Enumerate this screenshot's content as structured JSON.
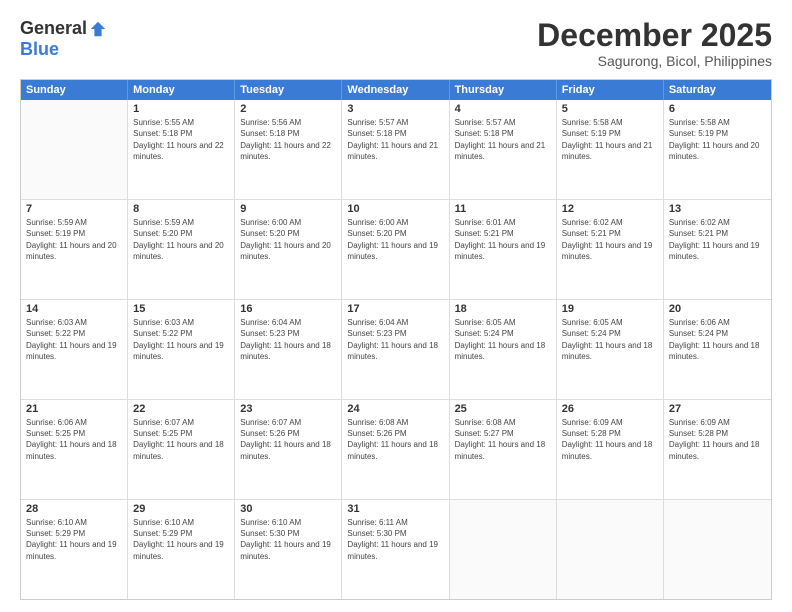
{
  "logo": {
    "general": "General",
    "blue": "Blue"
  },
  "title": "December 2025",
  "location": "Sagurong, Bicol, Philippines",
  "header_days": [
    "Sunday",
    "Monday",
    "Tuesday",
    "Wednesday",
    "Thursday",
    "Friday",
    "Saturday"
  ],
  "weeks": [
    [
      {
        "day": "",
        "sunrise": "",
        "sunset": "",
        "daylight": "",
        "empty": true
      },
      {
        "day": "1",
        "sunrise": "Sunrise: 5:55 AM",
        "sunset": "Sunset: 5:18 PM",
        "daylight": "Daylight: 11 hours and 22 minutes.",
        "empty": false
      },
      {
        "day": "2",
        "sunrise": "Sunrise: 5:56 AM",
        "sunset": "Sunset: 5:18 PM",
        "daylight": "Daylight: 11 hours and 22 minutes.",
        "empty": false
      },
      {
        "day": "3",
        "sunrise": "Sunrise: 5:57 AM",
        "sunset": "Sunset: 5:18 PM",
        "daylight": "Daylight: 11 hours and 21 minutes.",
        "empty": false
      },
      {
        "day": "4",
        "sunrise": "Sunrise: 5:57 AM",
        "sunset": "Sunset: 5:18 PM",
        "daylight": "Daylight: 11 hours and 21 minutes.",
        "empty": false
      },
      {
        "day": "5",
        "sunrise": "Sunrise: 5:58 AM",
        "sunset": "Sunset: 5:19 PM",
        "daylight": "Daylight: 11 hours and 21 minutes.",
        "empty": false
      },
      {
        "day": "6",
        "sunrise": "Sunrise: 5:58 AM",
        "sunset": "Sunset: 5:19 PM",
        "daylight": "Daylight: 11 hours and 20 minutes.",
        "empty": false
      }
    ],
    [
      {
        "day": "7",
        "sunrise": "Sunrise: 5:59 AM",
        "sunset": "Sunset: 5:19 PM",
        "daylight": "Daylight: 11 hours and 20 minutes.",
        "empty": false
      },
      {
        "day": "8",
        "sunrise": "Sunrise: 5:59 AM",
        "sunset": "Sunset: 5:20 PM",
        "daylight": "Daylight: 11 hours and 20 minutes.",
        "empty": false
      },
      {
        "day": "9",
        "sunrise": "Sunrise: 6:00 AM",
        "sunset": "Sunset: 5:20 PM",
        "daylight": "Daylight: 11 hours and 20 minutes.",
        "empty": false
      },
      {
        "day": "10",
        "sunrise": "Sunrise: 6:00 AM",
        "sunset": "Sunset: 5:20 PM",
        "daylight": "Daylight: 11 hours and 19 minutes.",
        "empty": false
      },
      {
        "day": "11",
        "sunrise": "Sunrise: 6:01 AM",
        "sunset": "Sunset: 5:21 PM",
        "daylight": "Daylight: 11 hours and 19 minutes.",
        "empty": false
      },
      {
        "day": "12",
        "sunrise": "Sunrise: 6:02 AM",
        "sunset": "Sunset: 5:21 PM",
        "daylight": "Daylight: 11 hours and 19 minutes.",
        "empty": false
      },
      {
        "day": "13",
        "sunrise": "Sunrise: 6:02 AM",
        "sunset": "Sunset: 5:21 PM",
        "daylight": "Daylight: 11 hours and 19 minutes.",
        "empty": false
      }
    ],
    [
      {
        "day": "14",
        "sunrise": "Sunrise: 6:03 AM",
        "sunset": "Sunset: 5:22 PM",
        "daylight": "Daylight: 11 hours and 19 minutes.",
        "empty": false
      },
      {
        "day": "15",
        "sunrise": "Sunrise: 6:03 AM",
        "sunset": "Sunset: 5:22 PM",
        "daylight": "Daylight: 11 hours and 19 minutes.",
        "empty": false
      },
      {
        "day": "16",
        "sunrise": "Sunrise: 6:04 AM",
        "sunset": "Sunset: 5:23 PM",
        "daylight": "Daylight: 11 hours and 18 minutes.",
        "empty": false
      },
      {
        "day": "17",
        "sunrise": "Sunrise: 6:04 AM",
        "sunset": "Sunset: 5:23 PM",
        "daylight": "Daylight: 11 hours and 18 minutes.",
        "empty": false
      },
      {
        "day": "18",
        "sunrise": "Sunrise: 6:05 AM",
        "sunset": "Sunset: 5:24 PM",
        "daylight": "Daylight: 11 hours and 18 minutes.",
        "empty": false
      },
      {
        "day": "19",
        "sunrise": "Sunrise: 6:05 AM",
        "sunset": "Sunset: 5:24 PM",
        "daylight": "Daylight: 11 hours and 18 minutes.",
        "empty": false
      },
      {
        "day": "20",
        "sunrise": "Sunrise: 6:06 AM",
        "sunset": "Sunset: 5:24 PM",
        "daylight": "Daylight: 11 hours and 18 minutes.",
        "empty": false
      }
    ],
    [
      {
        "day": "21",
        "sunrise": "Sunrise: 6:06 AM",
        "sunset": "Sunset: 5:25 PM",
        "daylight": "Daylight: 11 hours and 18 minutes.",
        "empty": false
      },
      {
        "day": "22",
        "sunrise": "Sunrise: 6:07 AM",
        "sunset": "Sunset: 5:25 PM",
        "daylight": "Daylight: 11 hours and 18 minutes.",
        "empty": false
      },
      {
        "day": "23",
        "sunrise": "Sunrise: 6:07 AM",
        "sunset": "Sunset: 5:26 PM",
        "daylight": "Daylight: 11 hours and 18 minutes.",
        "empty": false
      },
      {
        "day": "24",
        "sunrise": "Sunrise: 6:08 AM",
        "sunset": "Sunset: 5:26 PM",
        "daylight": "Daylight: 11 hours and 18 minutes.",
        "empty": false
      },
      {
        "day": "25",
        "sunrise": "Sunrise: 6:08 AM",
        "sunset": "Sunset: 5:27 PM",
        "daylight": "Daylight: 11 hours and 18 minutes.",
        "empty": false
      },
      {
        "day": "26",
        "sunrise": "Sunrise: 6:09 AM",
        "sunset": "Sunset: 5:28 PM",
        "daylight": "Daylight: 11 hours and 18 minutes.",
        "empty": false
      },
      {
        "day": "27",
        "sunrise": "Sunrise: 6:09 AM",
        "sunset": "Sunset: 5:28 PM",
        "daylight": "Daylight: 11 hours and 18 minutes.",
        "empty": false
      }
    ],
    [
      {
        "day": "28",
        "sunrise": "Sunrise: 6:10 AM",
        "sunset": "Sunset: 5:29 PM",
        "daylight": "Daylight: 11 hours and 19 minutes.",
        "empty": false
      },
      {
        "day": "29",
        "sunrise": "Sunrise: 6:10 AM",
        "sunset": "Sunset: 5:29 PM",
        "daylight": "Daylight: 11 hours and 19 minutes.",
        "empty": false
      },
      {
        "day": "30",
        "sunrise": "Sunrise: 6:10 AM",
        "sunset": "Sunset: 5:30 PM",
        "daylight": "Daylight: 11 hours and 19 minutes.",
        "empty": false
      },
      {
        "day": "31",
        "sunrise": "Sunrise: 6:11 AM",
        "sunset": "Sunset: 5:30 PM",
        "daylight": "Daylight: 11 hours and 19 minutes.",
        "empty": false
      },
      {
        "day": "",
        "sunrise": "",
        "sunset": "",
        "daylight": "",
        "empty": true
      },
      {
        "day": "",
        "sunrise": "",
        "sunset": "",
        "daylight": "",
        "empty": true
      },
      {
        "day": "",
        "sunrise": "",
        "sunset": "",
        "daylight": "",
        "empty": true
      }
    ]
  ]
}
